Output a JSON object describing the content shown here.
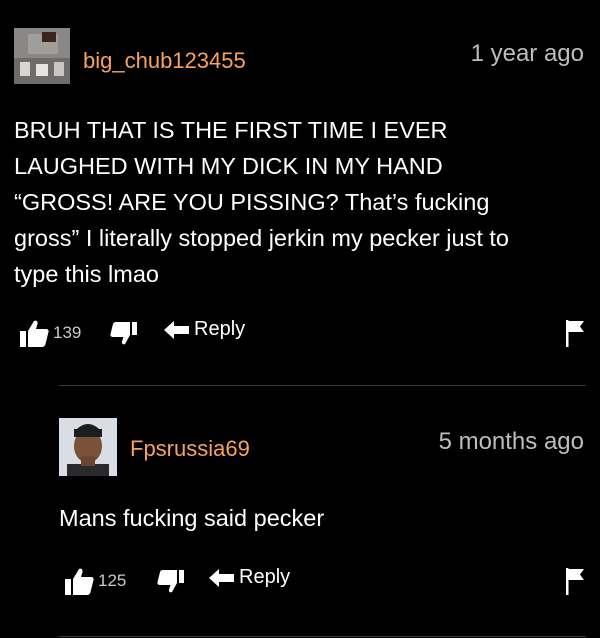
{
  "comments": [
    {
      "username": "big_chub123455",
      "timestamp": "1 year ago",
      "text_lines": [
        "BRUH THAT IS THE FIRST TIME I EVER",
        "LAUGHED WITH MY DICK IN MY HAND",
        "“GROSS! ARE YOU PISSING? That’s fucking",
        "gross” I literally stopped jerkin my pecker just to",
        "type this lmao"
      ],
      "likes": "139",
      "reply_label": "Reply"
    },
    {
      "username": "Fpsrussia69",
      "timestamp": "5 months ago",
      "text_lines": [
        "Mans fucking said pecker"
      ],
      "likes": "125",
      "reply_label": "Reply"
    }
  ],
  "colors": {
    "username": "#f7a35c",
    "timestamp": "#bdbdbd",
    "background": "#000000"
  },
  "icons": [
    "thumbs-up-icon",
    "thumbs-down-icon",
    "reply-arrow-icon",
    "flag-icon"
  ]
}
